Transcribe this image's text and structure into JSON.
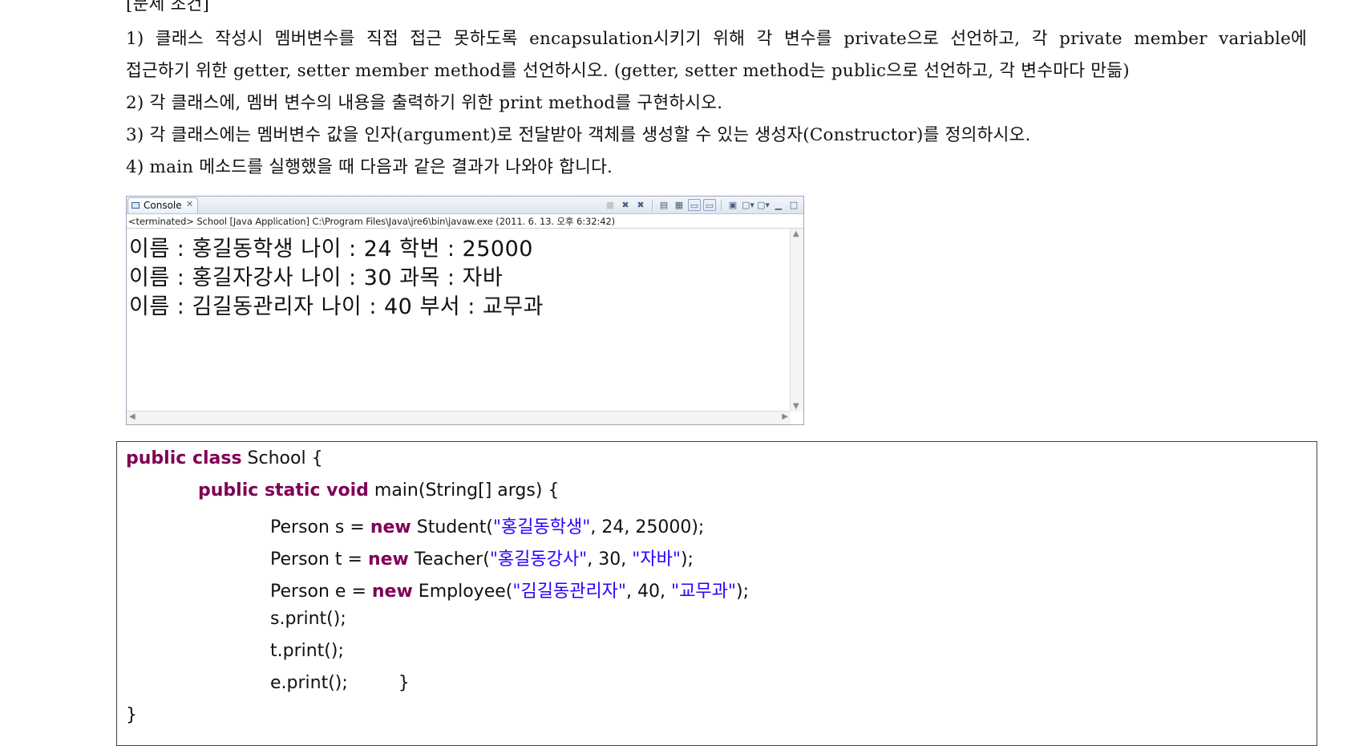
{
  "doc": {
    "heading": "[문제 조건]",
    "condition1_line1": "1) 클래스 작성시 멤버변수를 직접 접근 못하도록 encapsulation시키기 위해 각 변수를 private으로 선언하고, 각 private member variable에",
    "condition1_line2": "접근하기 위한 getter, setter member method를 선언하시오. (getter, setter method는 public으로 선언하고, 각 변수마다 만듦)",
    "condition2": "2) 각 클래스에, 멤버 변수의 내용을 출력하기 위한 print method를 구현하시오.",
    "condition3": "3) 각 클래스에는 멤버변수 값을 인자(argument)로 전달받아 객체를 생성할 수 있는 생성자(Constructor)를 정의하시오.",
    "condition4": "4) main 메소드를 실행했을 때 다음과 같은 결과가 나와야 합니다."
  },
  "console": {
    "tab_label": "Console",
    "tab_close": "✕",
    "status": "<terminated> School [Java Application] C:\\Program Files\\Java\\jre6\\bin\\javaw.exe (2011. 6. 13. 오후 6:32:42)",
    "toolbar_icons": [
      "terminate-icon",
      "remove-launch-icon",
      "remove-all-icon",
      "clear-console-icon",
      "scroll-lock-icon",
      "show-on-stdout-icon",
      "show-on-stderr-icon",
      "pin-console-icon",
      "display-selected-console-icon",
      "open-console-icon",
      "minimize-icon",
      "maximize-icon"
    ],
    "output": [
      "이름 : 홍길동학생  나이 : 24   학번 : 25000",
      "이름 : 홍길자강사  나이 : 30   과목 : 자바",
      "이름 : 김길동관리자  나이 : 40   부서 : 교무과"
    ]
  },
  "code": {
    "l1_kw": "public class",
    "l1_rest": " School {",
    "l2_kw": "public static void",
    "l2_rest": " main(String[] args) {",
    "l3_a": "Person s = ",
    "l3_kw": "new",
    "l3_b": " Student(",
    "l3_str": "\"홍길동학생\"",
    "l3_c": ", 24, 25000);",
    "l4_a": "Person t = ",
    "l4_kw": "new",
    "l4_b": " Teacher(",
    "l4_str1": "\"홍길동강사\"",
    "l4_c": ", 30, ",
    "l4_str2": "\"자바\"",
    "l4_d": ");",
    "l5_a": "Person e = ",
    "l5_kw": "new",
    "l5_b": " Employee(",
    "l5_str1": "\"김길동관리자\"",
    "l5_c": ", 40, ",
    "l5_str2": "\"교무과\"",
    "l5_d": ");",
    "l6": "s.print();",
    "l7": "t.print();",
    "l8": "e.print();         }",
    "l9": "}"
  },
  "colors": {
    "keyword": "#7f0055",
    "string": "#2a00ff"
  }
}
